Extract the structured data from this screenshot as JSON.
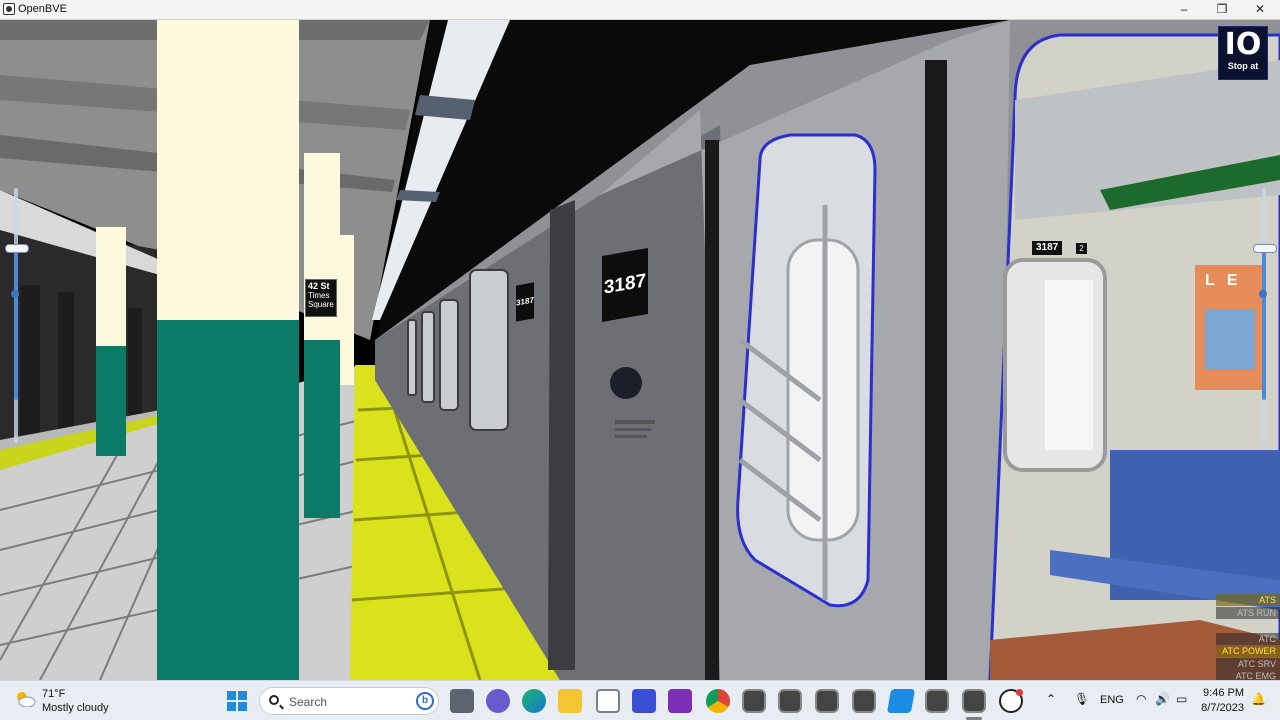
{
  "window": {
    "title": "OpenBVE",
    "minimize_label": "–",
    "maximize_label": "❐",
    "close_label": "✕"
  },
  "scene": {
    "platform_sign": {
      "line1": "42 St",
      "line2": "Times",
      "line3": "Square"
    },
    "car_number_primary": "3187",
    "car_number_secondary": "3187",
    "car_number_interior": "3187",
    "car_number_interior_line": "2",
    "poster_text": "L E"
  },
  "hud": {
    "destination_code": "IO",
    "destination_label": "Stop at",
    "indicators": [
      {
        "label": "ATS",
        "on": true
      },
      {
        "label": "ATS RUN",
        "on": false
      },
      {
        "label": "ATC",
        "on": false
      },
      {
        "label": "ATC POWER",
        "on": true
      },
      {
        "label": "ATC SRV",
        "on": false
      },
      {
        "label": "ATC EMG",
        "on": false
      }
    ]
  },
  "taskbar": {
    "weather_temp": "71°F",
    "weather_condition": "Mostly cloudy",
    "search_placeholder": "Search",
    "language": "ENG",
    "time": "9:46 PM",
    "date": "8/7/2023",
    "apps": [
      "start-icon",
      "task-view-icon",
      "chat-icon",
      "edge-icon",
      "file-explorer-icon",
      "store-icon",
      "powerautomate-icon",
      "onenote-icon",
      "chrome-icon",
      "openbve-icon",
      "openbve-icon",
      "openbve-icon",
      "openbve-icon",
      "vscode-icon",
      "openbve-icon",
      "openbve-icon",
      "obs-icon"
    ]
  }
}
